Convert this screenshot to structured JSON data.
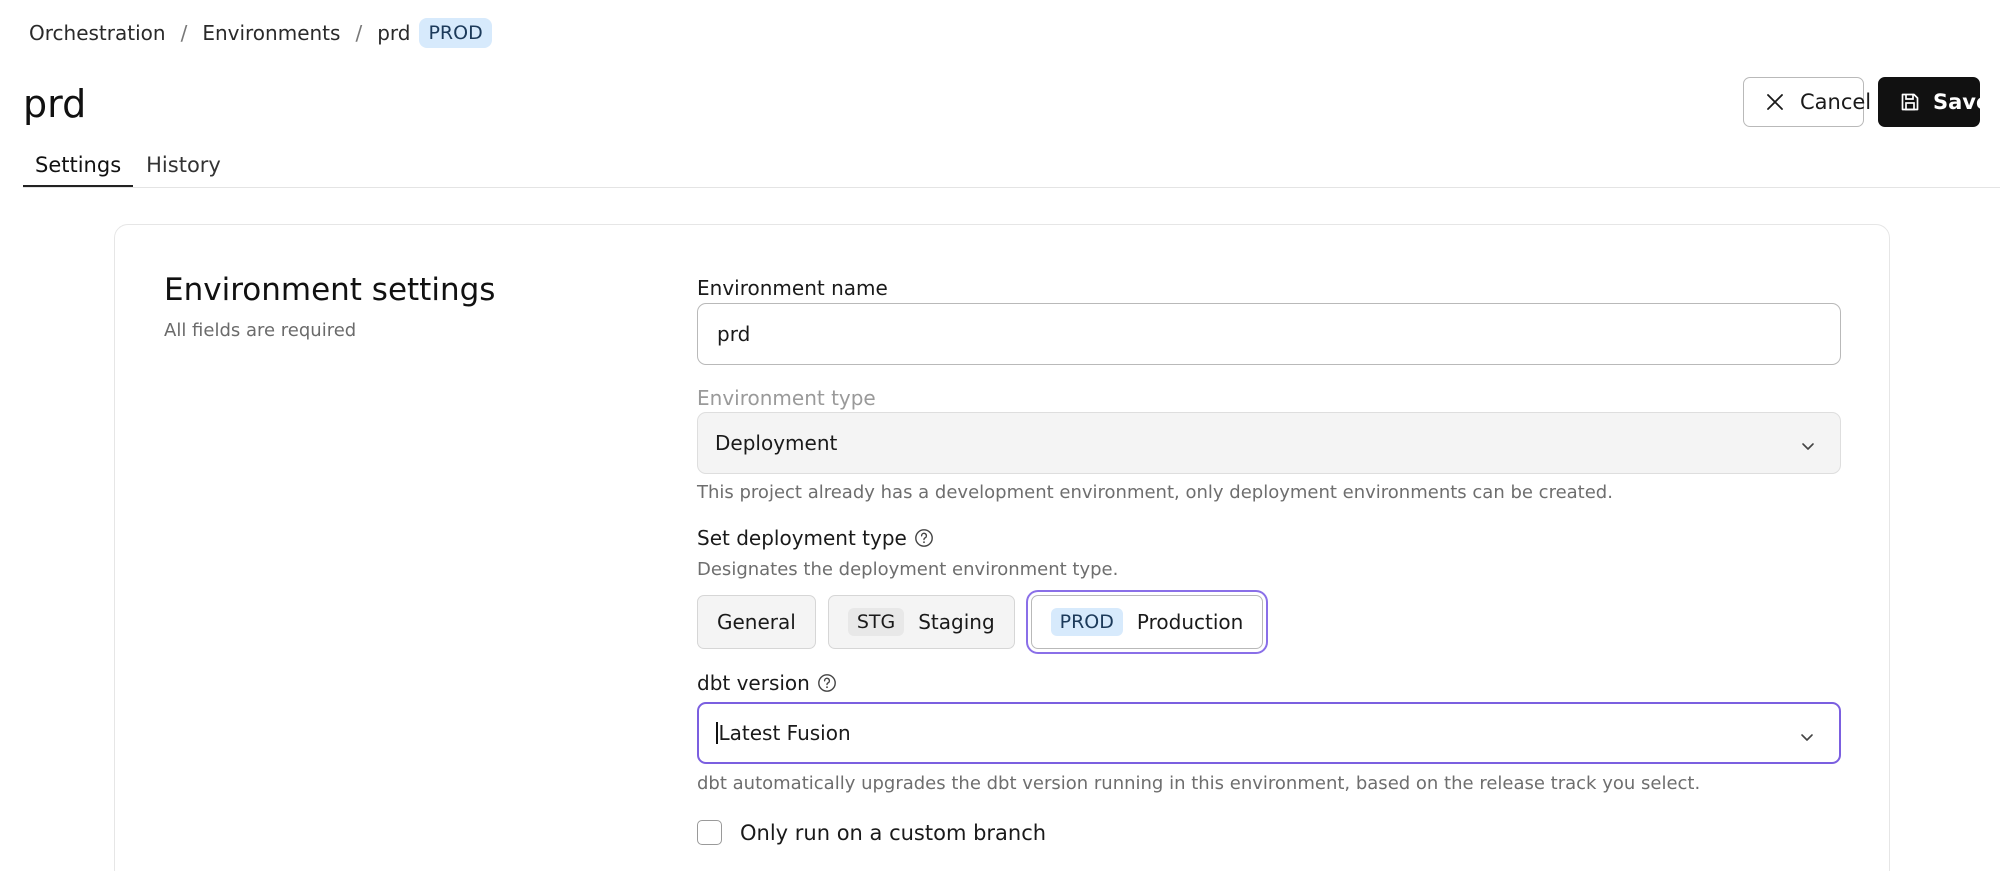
{
  "breadcrumb": {
    "items": [
      "Orchestration",
      "Environments",
      "prd"
    ],
    "separator": "/",
    "badge": "PROD"
  },
  "page": {
    "title": "prd"
  },
  "actions": {
    "cancel_label": "Cancel",
    "save_label": "Save"
  },
  "tabs": [
    {
      "label": "Settings",
      "active": true
    },
    {
      "label": "History",
      "active": false
    }
  ],
  "section": {
    "title": "Environment settings",
    "subtitle": "All fields are required"
  },
  "form": {
    "env_name": {
      "label": "Environment name",
      "value": "prd"
    },
    "env_type": {
      "label": "Environment type",
      "value": "Deployment",
      "hint": "This project already has a development environment, only deployment environments can be created."
    },
    "deploy_type": {
      "label": "Set deployment type",
      "hint": "Designates the deployment environment type.",
      "options": {
        "general": "General",
        "staging_chip": "STG",
        "staging": "Staging",
        "production_chip": "PROD",
        "production": "Production"
      },
      "selected": "Production"
    },
    "dbt_version": {
      "label": "dbt version",
      "value": "Latest Fusion",
      "hint": "dbt automatically upgrades the dbt version running in this environment, based on the release track you select."
    },
    "custom_branch": {
      "label": "Only run on a custom branch",
      "checked": false
    }
  },
  "colors": {
    "accent_focus": "#7b5fe0",
    "prod_badge_bg": "#d7eafc",
    "save_button_bg": "#111111"
  },
  "icons": [
    "close-icon",
    "save-icon",
    "help-icon",
    "chevron-down-icon"
  ]
}
